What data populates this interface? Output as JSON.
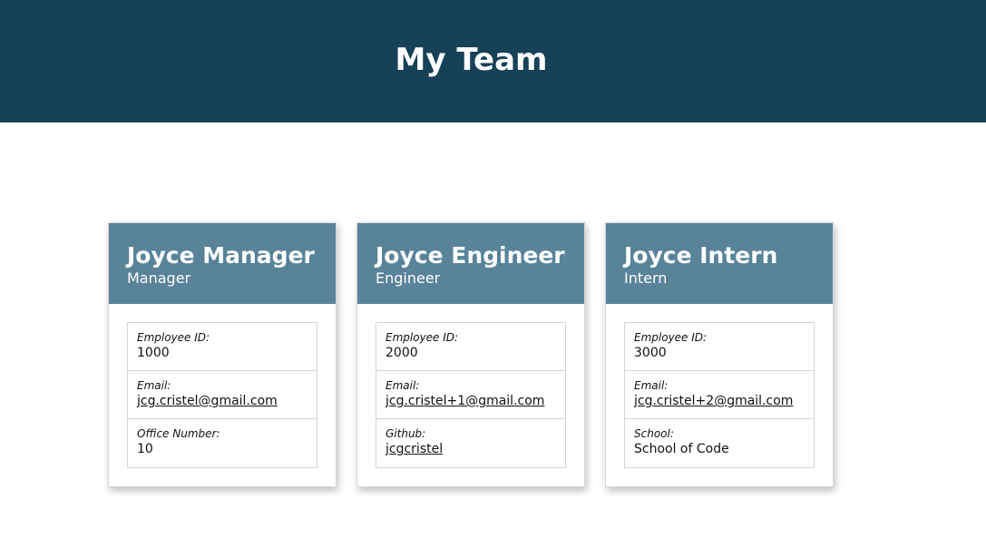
{
  "header": {
    "title": "My Team"
  },
  "cards": [
    {
      "name": "Joyce Manager",
      "role": "Manager",
      "rows": [
        {
          "label": "Employee ID:",
          "value": "1000"
        },
        {
          "label": "Email:",
          "value": "jcg.cristel@gmail.com"
        },
        {
          "label": "Office Number:",
          "value": "10"
        }
      ]
    },
    {
      "name": "Joyce Engineer",
      "role": "Engineer",
      "rows": [
        {
          "label": "Employee ID:",
          "value": "2000"
        },
        {
          "label": "Email:",
          "value": "jcg.cristel+1@gmail.com"
        },
        {
          "label": "Github:",
          "value": "jcgcristel"
        }
      ]
    },
    {
      "name": "Joyce Intern",
      "role": "Intern",
      "rows": [
        {
          "label": "Employee ID:",
          "value": "3000"
        },
        {
          "label": "Email:",
          "value": "jcg.cristel+2@gmail.com"
        },
        {
          "label": "School:",
          "value": "School of Code"
        }
      ]
    }
  ],
  "colors": {
    "header_bg": "#164157",
    "card_header_bg": "#588399"
  }
}
